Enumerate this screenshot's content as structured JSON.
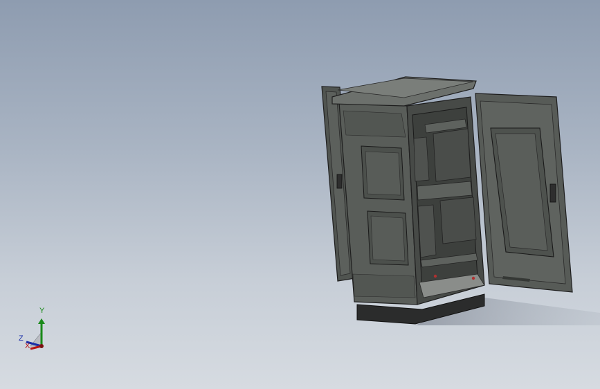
{
  "viewport": {
    "background_top": "#8e9cb0",
    "background_bottom": "#d6dbe1"
  },
  "model": {
    "icon": "cabinet-model-icon"
  },
  "triad": {
    "x_label": "X",
    "y_label": "Y",
    "z_label": "Z",
    "x_color": "#b81414",
    "y_color": "#1a8a1a",
    "z_color": "#1a2ea8"
  }
}
